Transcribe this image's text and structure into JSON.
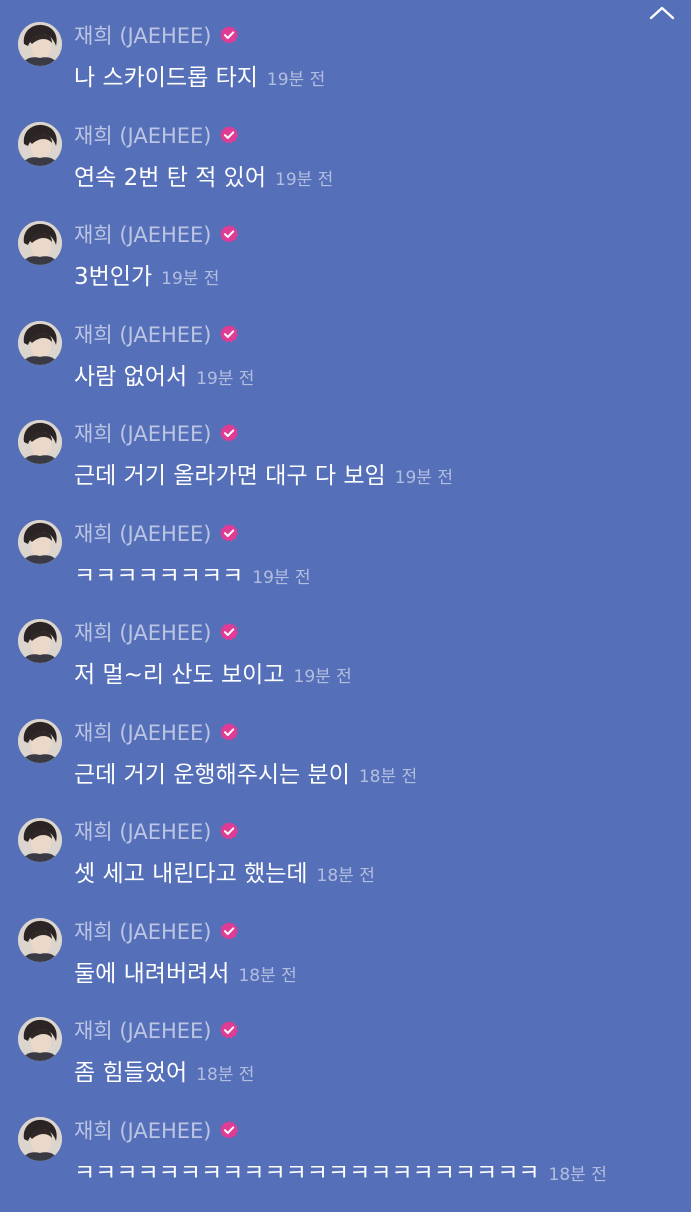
{
  "sender": {
    "name": "재희 (JAEHEE)",
    "verified_color": "#e03c95",
    "icon": "verified-check-icon"
  },
  "messages": [
    {
      "text": "나 스카이드롭 타지",
      "time": "19분 전"
    },
    {
      "text": "연속 2번 탄 적 있어",
      "time": "19분 전"
    },
    {
      "text": "3번인가",
      "time": "19분 전"
    },
    {
      "text": "사람 없어서",
      "time": "19분 전"
    },
    {
      "text": "근데 거기 올라가면 대구 다 보임",
      "time": "19분 전"
    },
    {
      "text": "ㅋㅋㅋㅋㅋㅋㅋㅋ",
      "time": "19분 전"
    },
    {
      "text": "저 멀~리 산도 보이고",
      "time": "19분 전"
    },
    {
      "text": "근데 거기 운행해주시는 분이",
      "time": "18분 전"
    },
    {
      "text": "셋 세고 내린다고 했는데",
      "time": "18분 전"
    },
    {
      "text": "둘에 내려버려서",
      "time": "18분 전"
    },
    {
      "text": "좀 힘들었어",
      "time": "18분 전"
    },
    {
      "text": "ㅋㅋㅋㅋㅋㅋㅋㅋㅋㅋㅋㅋㅋㅋㅋㅋㅋㅋㅋㅋㅋㅋ",
      "time": "18분 전"
    }
  ]
}
